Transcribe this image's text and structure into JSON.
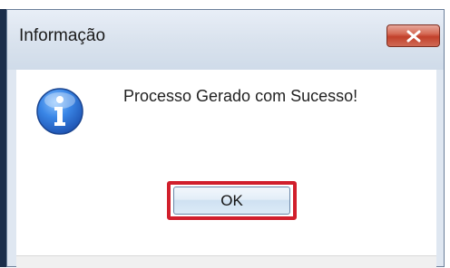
{
  "dialog": {
    "title": "Informação",
    "message": "Processo Gerado com Sucesso!",
    "ok_label": "OK",
    "close_icon": "close-icon",
    "info_icon": "info-icon"
  },
  "colors": {
    "highlight": "#d11f2c",
    "close_button": "#c2402b",
    "icon_blue": "#2f6fd2"
  }
}
